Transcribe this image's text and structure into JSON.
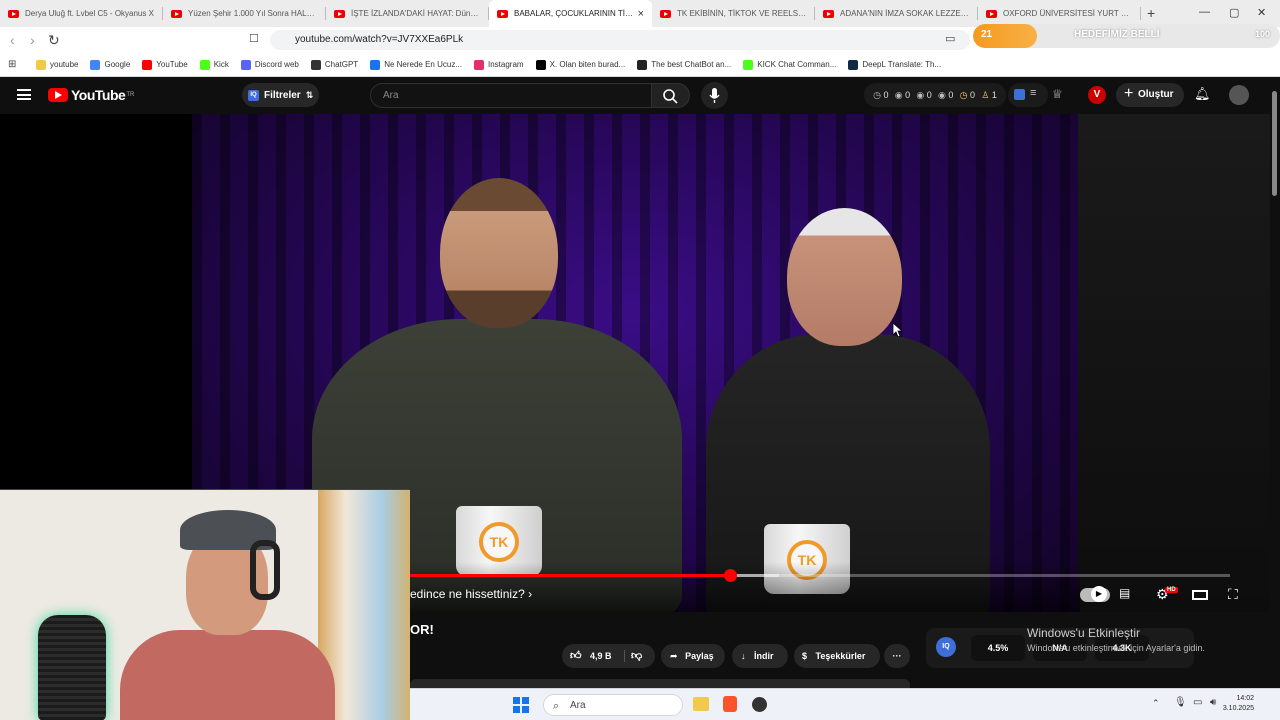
{
  "browser": {
    "tabs": [
      {
        "title": "Derya Uluğ ft. Lvbel C5 - Okyanus X"
      },
      {
        "title": "Yüzen Şehir 1.000 Yıl Sonra HALA N"
      },
      {
        "title": "İŞTE İZLANDA'DAKİ HAYAT: Dünyanı"
      },
      {
        "title": "BABALAR, ÇOCUKLARININ TİKTO"
      },
      {
        "title": "TK EKİBİNİN, TİKTOK VE REELS VİDEO"
      },
      {
        "title": "ADANA'NIN İMZA SOKAK LEZZETLER"
      },
      {
        "title": "OXFORD ÜNİVERSİTESİ YURT ODASI"
      }
    ],
    "active_tab_index": 3,
    "url": "youtube.com/watch?v=JV7XXEa6PLk",
    "goal_widget": {
      "count": "21",
      "label": "HEDEFİMİZ BELLİ",
      "end": "100",
      "progress_fraction": 0.21
    },
    "bookmarks": [
      {
        "label": "youtube",
        "icon": "folder-icon",
        "color": "#f2c94c"
      },
      {
        "label": "Google",
        "icon": "google-icon",
        "color": "#4285f4"
      },
      {
        "label": "YouTube",
        "icon": "youtube-icon",
        "color": "#ff0000"
      },
      {
        "label": "Kick",
        "icon": "kick-icon",
        "color": "#53fc18"
      },
      {
        "label": "Discord web",
        "icon": "discord-icon",
        "color": "#5865f2"
      },
      {
        "label": "ChatGPT",
        "icon": "chatgpt-icon",
        "color": "#333333"
      },
      {
        "label": "Ne Nerede En Ucuz...",
        "icon": "check-icon",
        "color": "#1a73e8"
      },
      {
        "label": "Instagram",
        "icon": "instagram-icon",
        "color": "#e1306c"
      },
      {
        "label": "X. Olan biten burad...",
        "icon": "x-icon",
        "color": "#000000"
      },
      {
        "label": "The best ChatBot an...",
        "icon": "chatbot-icon",
        "color": "#222222"
      },
      {
        "label": "KICK Chat Comman...",
        "icon": "kick-icon",
        "color": "#53fc18"
      },
      {
        "label": "DeepL Translate: Th...",
        "icon": "deepl-icon",
        "color": "#0f2b46"
      }
    ]
  },
  "youtube": {
    "logo_text": "YouTube",
    "region": "TR",
    "filters_label": "Filtreler",
    "search_placeholder": "Ara",
    "stats": [
      "0",
      "0",
      "0",
      "0",
      "0",
      "1"
    ],
    "create_label": "Oluştur",
    "channel_badge": "V"
  },
  "video": {
    "chapter_text": "edince ne hissettiniz?",
    "played_fraction": 0.39,
    "buffered_fraction": 0.45,
    "hd_badge": "HD",
    "title_fragment": "OR!",
    "actions": {
      "likes": "4,9 B",
      "share": "Paylaş",
      "download": "İndir",
      "thanks": "Teşekkürler"
    },
    "mug_logo": "TK"
  },
  "extension_panel": {
    "badge": "IQ",
    "values": [
      "4.5%",
      "N/A",
      "4.3K"
    ]
  },
  "windows": {
    "activation_title": "Windows'u Etkinleştir",
    "activation_sub": "Windows'u etkinleştirmek için Ayarlar'a gidin.",
    "taskbar_search": "Ara",
    "time": "14:02",
    "date": "3.10.2025"
  }
}
